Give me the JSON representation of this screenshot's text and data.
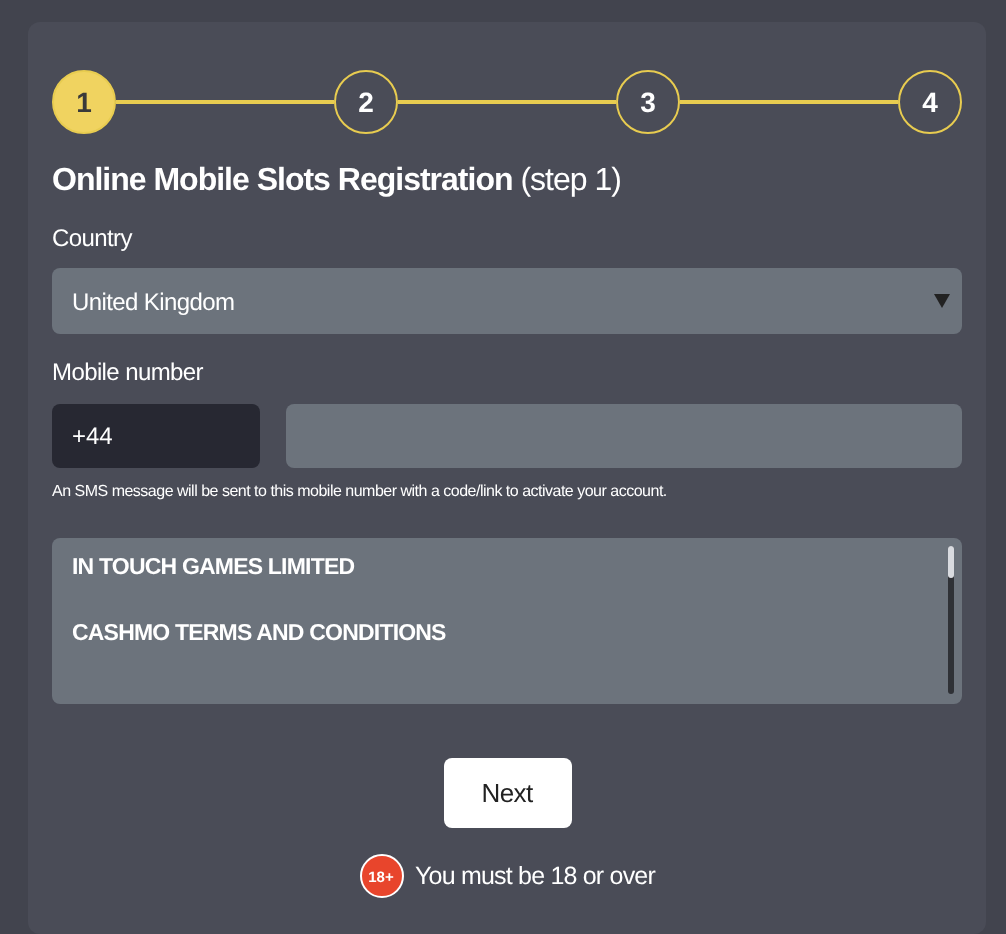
{
  "steps": [
    {
      "label": "1",
      "selected": true
    },
    {
      "label": "2",
      "selected": false
    },
    {
      "label": "3",
      "selected": false
    },
    {
      "label": "4",
      "selected": false
    }
  ],
  "title": "Online Mobile Slots Registration",
  "title_suffix": "(step 1)",
  "country": {
    "label": "Country",
    "value": "United Kingdom"
  },
  "mobile": {
    "label": "Mobile number",
    "prefix": "+44",
    "hint": "An SMS message will be sent to this mobile number with a code/link to activate your account."
  },
  "terms": [
    "IN TOUCH GAMES LIMITED",
    "CASHMO TERMS AND CONDITIONS"
  ],
  "next_button": "Next",
  "age_notice": {
    "badge": "18+",
    "text": "You must be 18 or over"
  }
}
